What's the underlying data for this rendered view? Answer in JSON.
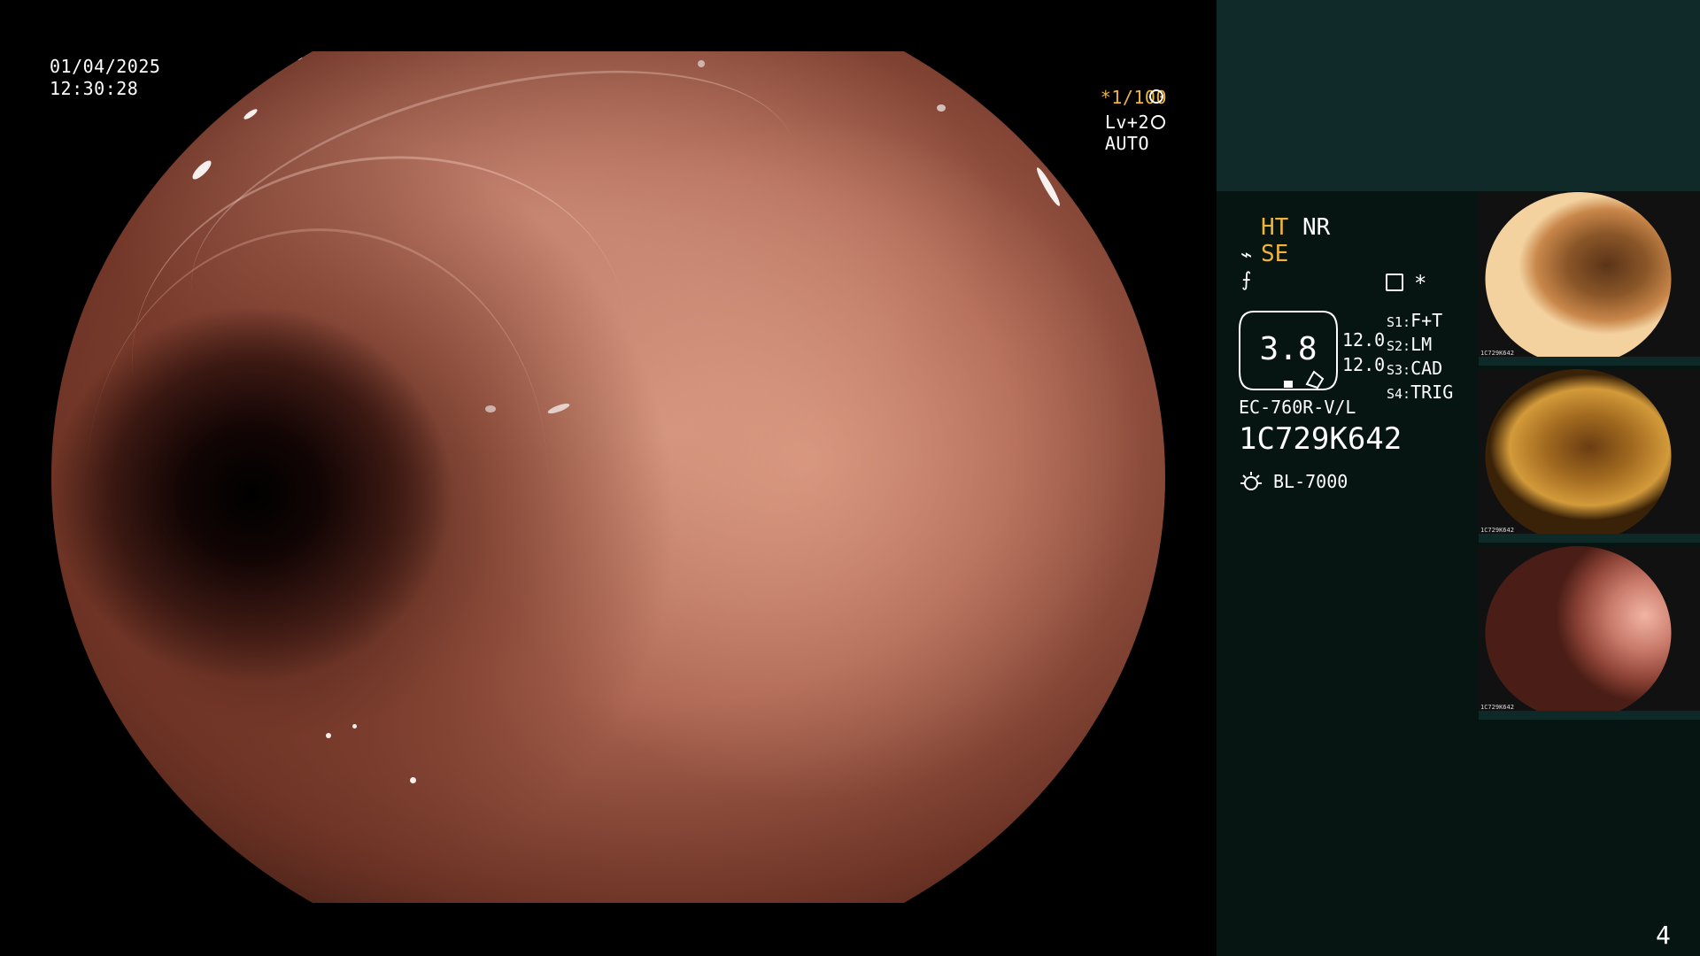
{
  "datetime": {
    "date": "01/04/2025",
    "time": "12:30:28"
  },
  "osd_right": {
    "shutter": "*1/100",
    "level": "Lv+2 AUTO"
  },
  "panel": {
    "ht": "HT",
    "nr": "NR",
    "se": "SE",
    "magnification": "3.8",
    "value1": "12.0",
    "value2": "12.0",
    "s1_label": "S1:",
    "s1_value": "F+T",
    "s2_label": "S2:",
    "s2_value": "LM",
    "s3_label": "S3:",
    "s3_value": "CAD",
    "s4_label": "S4:",
    "s4_value": "TRIG",
    "scope_model": "EC-760R-V/L",
    "serial": "1C729K642",
    "light_source": "BL-7000",
    "asterisk": "*"
  },
  "thumbnails": [
    {
      "id": "thumb-1",
      "serial": "1C729K642",
      "index": "3"
    },
    {
      "id": "thumb-2",
      "serial": "1C729K642",
      "index": "2"
    },
    {
      "id": "thumb-3",
      "serial": "1C729K642",
      "index": "1"
    }
  ],
  "page_number": "4",
  "colors": {
    "accent_yellow": "#f0b43c",
    "panel_bg": "#061512",
    "panel_top_bg": "#0f2a29"
  }
}
